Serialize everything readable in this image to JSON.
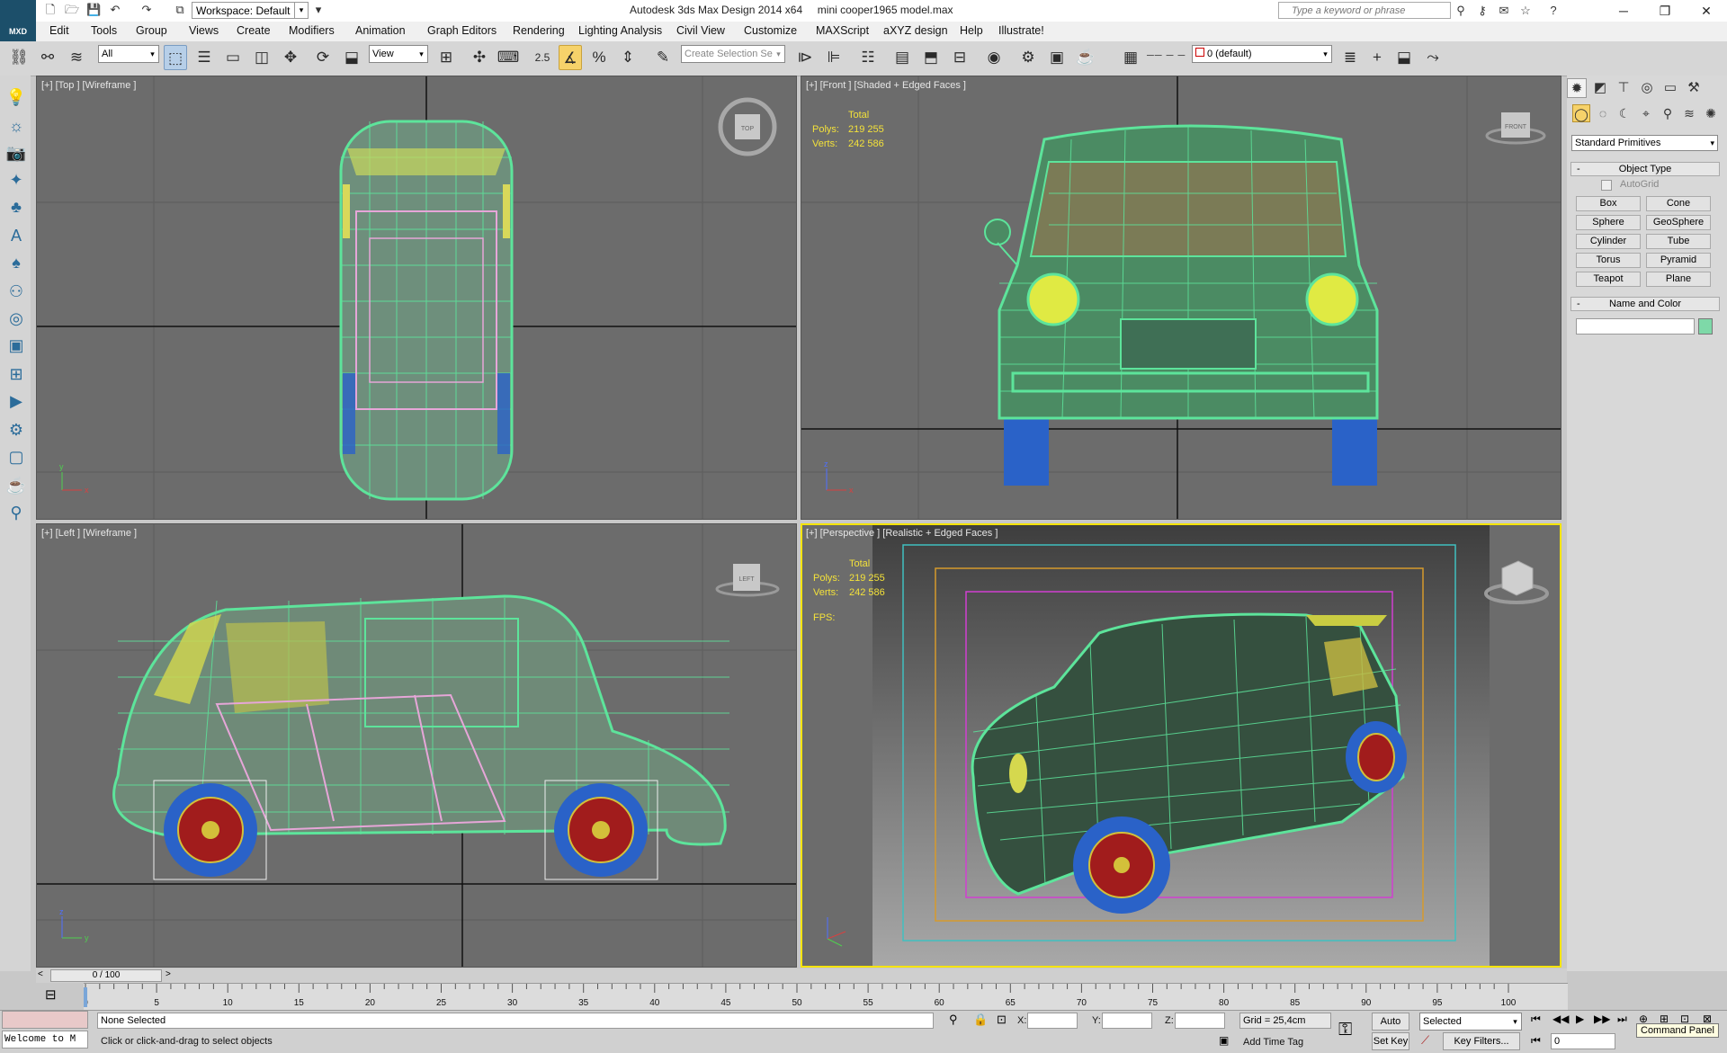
{
  "app": {
    "logo_text": "MXD",
    "workspace": "Workspace: Default",
    "title": "Autodesk 3ds Max Design 2014 x64",
    "file": "mini cooper1965 model.max",
    "search_placeholder": "Type a keyword or phrase"
  },
  "menu": [
    "Edit",
    "Tools",
    "Group",
    "Views",
    "Create",
    "Modifiers",
    "Animation",
    "Graph Editors",
    "Rendering",
    "Lighting Analysis",
    "Civil View",
    "Customize",
    "MAXScript",
    "aXYZ design",
    "Help",
    "Illustrate!"
  ],
  "toolbar": {
    "filter": "All",
    "ref_coord": "View",
    "snap_label": "2.5",
    "selection_set_placeholder": "Create Selection Se",
    "layer": "0 (default)"
  },
  "viewports": {
    "top": {
      "label": "[+] [Top ] [Wireframe ]",
      "cube": "TOP"
    },
    "front": {
      "label": "[+] [Front ] [Shaded + Edged Faces ]",
      "cube": "FRONT",
      "stats": {
        "title": "Total",
        "polys_label": "Polys:",
        "polys": "219 255",
        "verts_label": "Verts:",
        "verts": "242 586"
      }
    },
    "left": {
      "label": "[+] [Left ] [Wireframe ]",
      "cube": "LEFT"
    },
    "perspective": {
      "label": "[+] [Perspective ] [Realistic + Edged Faces ]",
      "stats": {
        "title": "Total",
        "polys_label": "Polys:",
        "polys": "219 255",
        "verts_label": "Verts:",
        "verts": "242 586",
        "fps_label": "FPS:"
      }
    }
  },
  "command_panel": {
    "category": "Standard Primitives",
    "object_type_title": "Object Type",
    "autogrid": "AutoGrid",
    "buttons": [
      "Box",
      "Cone",
      "Sphere",
      "GeoSphere",
      "Cylinder",
      "Tube",
      "Torus",
      "Pyramid",
      "Teapot",
      "Plane"
    ],
    "name_color_title": "Name and Color",
    "name_value": "",
    "color": "#7ed9a8"
  },
  "timeline": {
    "frame": "0 / 100",
    "ticks": [
      "0",
      "5",
      "10",
      "15",
      "20",
      "25",
      "30",
      "35",
      "40",
      "45",
      "50",
      "55",
      "60",
      "65",
      "70",
      "75",
      "80",
      "85",
      "90",
      "95",
      "100"
    ]
  },
  "status": {
    "script_listener": "Welcome to M",
    "selection": "None Selected",
    "prompt": "Click or click-and-drag to select objects",
    "x_label": "X:",
    "y_label": "Y:",
    "z_label": "Z:",
    "grid": "Grid = 25,4cm",
    "add_time_tag": "Add Time Tag",
    "auto_key": "Auto Key",
    "set_key": "Set Key",
    "key_mode": "Selected",
    "key_filters": "Key Filters...",
    "current_frame": "0",
    "tooltip": "Command Panel"
  },
  "colors": {
    "viewport_bg": "#6b6b6b",
    "wire": "#5de49b",
    "active_border": "#f5e400",
    "stats": "#f4e23a",
    "wheel_blue": "#2a62c8",
    "wheel_red": "#a11c1c"
  }
}
